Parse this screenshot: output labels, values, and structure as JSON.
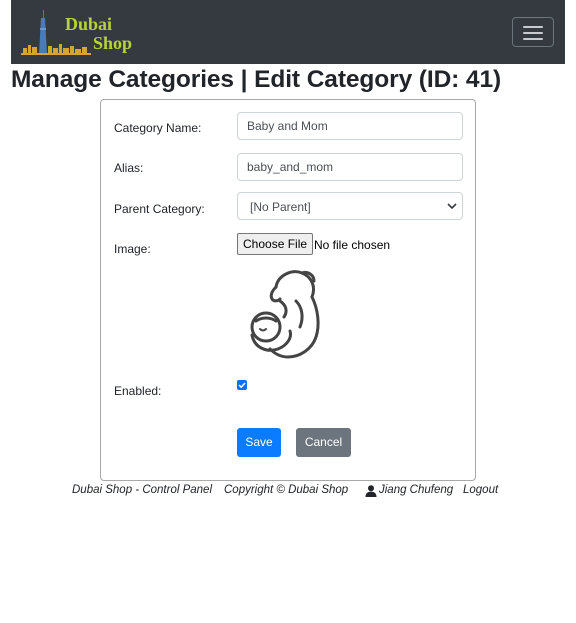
{
  "brand": {
    "line1": "Dubai",
    "line2": "Shop"
  },
  "navbar": {
    "toggler_icon": "hamburger-icon"
  },
  "page": {
    "title": "Manage Categories | Edit Category (ID: 41)"
  },
  "form": {
    "name_label": "Category Name:",
    "name_value": "Baby and Mom",
    "alias_label": "Alias:",
    "alias_value": "baby_and_mom",
    "parent_label": "Parent Category:",
    "parent_value": "[No Parent]",
    "image_label": "Image:",
    "file_button": "Choose File",
    "file_status": "No file chosen",
    "image_icon": "mother-baby-image",
    "enabled_label": "Enabled:",
    "enabled": true,
    "save_label": "Save",
    "cancel_label": "Cancel"
  },
  "footer": {
    "panel": "Dubai Shop - Control Panel",
    "copyright": "Copyright © Dubai Shop",
    "user": "Jiang Chufeng",
    "logout": "Logout"
  },
  "colors": {
    "navbar": "#343a40",
    "primary": "#0b7bff",
    "secondary": "#6c757d",
    "brand": "#b7d334"
  }
}
